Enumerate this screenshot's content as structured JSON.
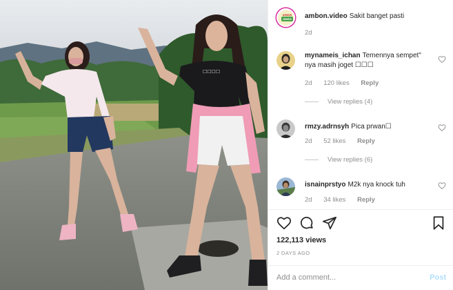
{
  "caption": {
    "username": "ambon.video",
    "text": "Sakit banget pasti",
    "time": "2d",
    "avatar_text": "AMBON VIDEO"
  },
  "comments": [
    {
      "username": "mynameis_ichan",
      "text": "Temennya sempet\" nya masih joget ☐☐☐",
      "time": "2d",
      "likes": "120 likes",
      "reply": "Reply",
      "view_replies": "View replies (4)"
    },
    {
      "username": "rmzy.adrnsyh",
      "text": "Pica prwan☐",
      "time": "2d",
      "likes": "52 likes",
      "reply": "Reply",
      "view_replies": "View replies (6)"
    },
    {
      "username": "isnainprstyo",
      "text": "M2k nya knock tuh",
      "time": "2d",
      "likes": "34 likes",
      "reply": "Reply"
    }
  ],
  "stats": {
    "views": "122,113 views",
    "date": "2 DAYS AGO"
  },
  "composer": {
    "placeholder": "Add a comment...",
    "post_label": "Post"
  },
  "icons": [
    "heart-icon",
    "comment-icon",
    "share-icon",
    "bookmark-icon"
  ],
  "colors": {
    "link_disabled": "#b2dffc",
    "secondary_text": "#8e8e8e",
    "primary_text": "#262626"
  }
}
